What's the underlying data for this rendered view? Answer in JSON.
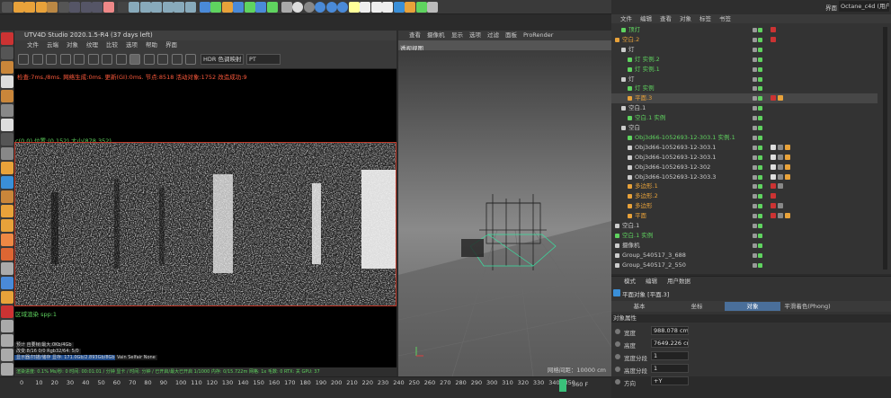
{
  "top_menu_right": "Octane_c4d (用户)",
  "top_right_label": "界面",
  "render_window": {
    "title": "UTV4D Studio 2020.1.5-R4 (37 days left)",
    "menu": [
      "文件",
      "云端",
      "对象",
      "纹理",
      "比较",
      "选项",
      "帮助",
      "界面"
    ],
    "hdr_select": "HDR 色调映射",
    "pt_select": "PT",
    "info_line": "检查:7ms./8ms. 网络生成:0ms. 更新(GI):0ms. 节点:8518 活动对象:1752 改造成功:9",
    "pos_line": "c(0,0) 位置:(0.152) 大小(878,352)",
    "status_line": "区域渲染 spp:1",
    "stats": [
      "预计 自要帧/最大:0Kb/4Gb",
      "改变:8/16 0/0          Rgb32/64: 5/0",
      "显示器/扫描/储存 显存: 171.0Gb/2.893Gb/8Gb",
      "Vain Selfair None"
    ],
    "bottom_bar": "渲染进度: 0.1%   Ms/秒: 0  时间: 00:01:01 / 分钟 显卡 / 时间: 分钟 / 已开启/最大已开启 1/1000  内存: 0/15.722m  网格: 1x  毛数: 0  RTX: 关  GPU: 37"
  },
  "viewport": {
    "menu": [
      "查看",
      "摄像机",
      "显示",
      "选项",
      "过滤",
      "面板",
      "ProRender"
    ],
    "label": "透视视图",
    "grid_spacing": "网格间距：10000 cm"
  },
  "object_manager": {
    "tabs": [
      "文件",
      "编辑",
      "查看",
      "对象",
      "标签",
      "书签"
    ],
    "rows": [
      {
        "name": "顶灯",
        "indent": 1,
        "color": "#5fd35f",
        "tags": [
          "#c33"
        ]
      },
      {
        "name": "空白.2",
        "indent": 0,
        "color": "#e8a23a",
        "tags": [
          "#c33"
        ]
      },
      {
        "name": "灯",
        "indent": 1,
        "color": "#cccccc",
        "tags": []
      },
      {
        "name": "灯 实例.2",
        "indent": 2,
        "color": "#5fd35f",
        "tags": []
      },
      {
        "name": "灯 实例.1",
        "indent": 2,
        "color": "#5fd35f",
        "tags": []
      },
      {
        "name": "灯",
        "indent": 1,
        "color": "#cccccc",
        "tags": []
      },
      {
        "name": "灯 实例",
        "indent": 2,
        "color": "#5fd35f",
        "tags": []
      },
      {
        "name": "平面.3",
        "indent": 2,
        "color": "#e8a23a",
        "tags": [
          "#c33",
          "#e8a23a"
        ]
      },
      {
        "name": "空白.1",
        "indent": 1,
        "color": "#cccccc",
        "tags": []
      },
      {
        "name": "空白.1 实例",
        "indent": 2,
        "color": "#5fd35f",
        "tags": []
      },
      {
        "name": "空白",
        "indent": 1,
        "color": "#cccccc",
        "tags": []
      },
      {
        "name": "Obj3d66-1052693-12-303.1 实例.1",
        "indent": 2,
        "color": "#5fd35f",
        "tags": []
      },
      {
        "name": "Obj3d66-1052693-12-303.1",
        "indent": 2,
        "color": "#cccccc",
        "tags": [
          "#ddd",
          "#888",
          "#e8a23a"
        ]
      },
      {
        "name": "Obj3d66-1052693-12-303.1",
        "indent": 2,
        "color": "#cccccc",
        "tags": [
          "#ddd",
          "#888",
          "#e8a23a"
        ]
      },
      {
        "name": "Obj3d66-1052693-12-302",
        "indent": 2,
        "color": "#cccccc",
        "tags": [
          "#ddd",
          "#888",
          "#e8a23a"
        ]
      },
      {
        "name": "Obj3d66-1052693-12-303.3",
        "indent": 2,
        "color": "#cccccc",
        "tags": [
          "#ddd",
          "#888",
          "#e8a23a"
        ]
      },
      {
        "name": "多边形.1",
        "indent": 2,
        "color": "#e8a23a",
        "tags": [
          "#c33",
          "#888"
        ]
      },
      {
        "name": "多边形.2",
        "indent": 2,
        "color": "#e8a23a",
        "tags": [
          "#c33"
        ]
      },
      {
        "name": "多边形",
        "indent": 2,
        "color": "#e8a23a",
        "tags": [
          "#c33",
          "#888"
        ]
      },
      {
        "name": "平面",
        "indent": 2,
        "color": "#e8a23a",
        "tags": [
          "#c33",
          "#888",
          "#e8a23a"
        ]
      },
      {
        "name": "空白.1",
        "indent": 0,
        "color": "#cccccc",
        "tags": []
      },
      {
        "name": "空白.1 实例",
        "indent": 0,
        "color": "#5fd35f",
        "tags": []
      },
      {
        "name": "摄像机",
        "indent": 0,
        "color": "#cccccc",
        "tags": []
      },
      {
        "name": "Group_540517_3_688",
        "indent": 0,
        "color": "#cccccc",
        "tags": []
      },
      {
        "name": "Group_540517_2_550",
        "indent": 0,
        "color": "#cccccc",
        "tags": []
      }
    ]
  },
  "attributes": {
    "tabs": [
      "模式",
      "编辑",
      "用户数据"
    ],
    "title": "平面对象 [平面.3]",
    "subtabs": [
      "基本",
      "坐标",
      "对象",
      "平滑着色(Phong)"
    ],
    "active_subtab": 2,
    "section": "对象属性",
    "fields": [
      {
        "label": "宽度",
        "value": "988.078 cm"
      },
      {
        "label": "高度",
        "value": "7649.226 cm"
      },
      {
        "label": "宽度分段",
        "value": "1"
      },
      {
        "label": "高度分段",
        "value": "1"
      },
      {
        "label": "方向",
        "value": "+Y"
      }
    ]
  },
  "timeline": {
    "ticks": [
      "0",
      "10",
      "20",
      "30",
      "40",
      "50",
      "60",
      "70",
      "80",
      "90",
      "100",
      "110",
      "120",
      "130",
      "140",
      "150",
      "160",
      "170",
      "180",
      "190",
      "200",
      "210",
      "220",
      "230",
      "240",
      "250",
      "260",
      "270",
      "280",
      "290",
      "300",
      "310",
      "320",
      "330",
      "340",
      "350"
    ],
    "frame": "360 F"
  }
}
